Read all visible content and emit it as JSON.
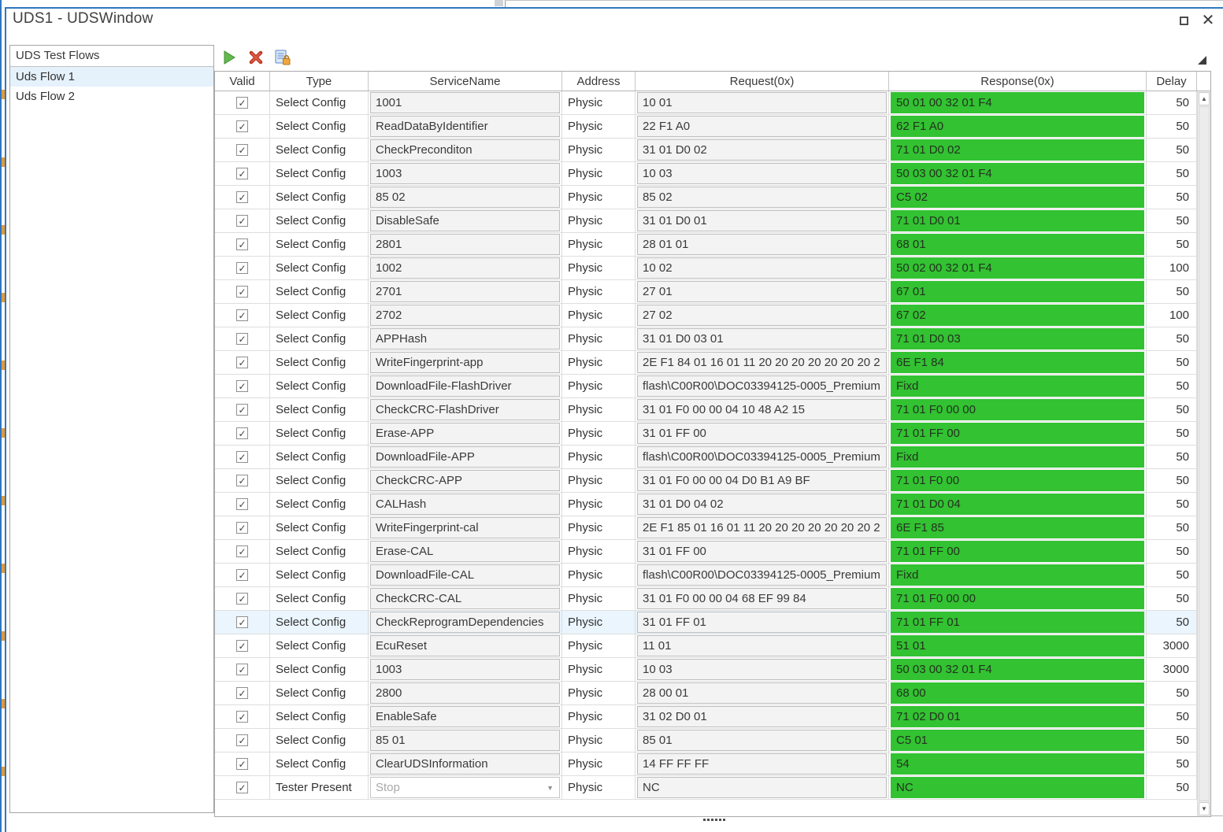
{
  "window": {
    "title": "UDS1 - UDSWindow",
    "close_glyph": "✕"
  },
  "sidebar": {
    "header": "UDS Test Flows",
    "items": [
      {
        "label": "Uds Flow 1",
        "selected": true
      },
      {
        "label": "Uds Flow 2",
        "selected": false
      }
    ]
  },
  "toolbar": {
    "icons": [
      "run",
      "delete",
      "report-locked"
    ]
  },
  "icons": {
    "check": "✓",
    "dropdown_arrow": "▼",
    "scroll_up": "▲",
    "scroll_down": "▼"
  },
  "colors": {
    "accent_blue": "#2e77c0",
    "response_green": "#32c232",
    "selection_blue": "#eaf5fd",
    "run_green": "#64b94e",
    "delete_red": "#c23825",
    "lock_orange": "#f2a73d"
  },
  "table": {
    "columns": [
      "Valid",
      "Type",
      "ServiceName",
      "Address",
      "Request(0x)",
      "Response(0x)",
      "Delay"
    ],
    "rows": [
      {
        "valid": true,
        "type": "Select Config",
        "service": "1001",
        "address": "Physic",
        "request": "10 01",
        "response": "50 01 00 32 01 F4",
        "delay": "50"
      },
      {
        "valid": true,
        "type": "Select Config",
        "service": "ReadDataByIdentifier",
        "address": "Physic",
        "request": "22 F1 A0",
        "response": "62 F1 A0",
        "delay": "50"
      },
      {
        "valid": true,
        "type": "Select Config",
        "service": "CheckPreconditon",
        "address": "Physic",
        "request": "31 01 D0 02",
        "response": "71 01 D0 02",
        "delay": "50"
      },
      {
        "valid": true,
        "type": "Select Config",
        "service": "1003",
        "address": "Physic",
        "request": "10 03",
        "response": "50 03 00 32 01 F4",
        "delay": "50"
      },
      {
        "valid": true,
        "type": "Select Config",
        "service": "85 02",
        "address": "Physic",
        "request": "85 02",
        "response": "C5 02",
        "delay": "50"
      },
      {
        "valid": true,
        "type": "Select Config",
        "service": "DisableSafe",
        "address": "Physic",
        "request": "31 01 D0 01",
        "response": "71 01 D0 01",
        "delay": "50"
      },
      {
        "valid": true,
        "type": "Select Config",
        "service": "2801",
        "address": "Physic",
        "request": "28 01 01",
        "response": "68 01",
        "delay": "50"
      },
      {
        "valid": true,
        "type": "Select Config",
        "service": "1002",
        "address": "Physic",
        "request": "10 02",
        "response": "50 02 00 32 01 F4",
        "delay": "100"
      },
      {
        "valid": true,
        "type": "Select Config",
        "service": "2701",
        "address": "Physic",
        "request": "27 01",
        "response": "67 01",
        "delay": "50"
      },
      {
        "valid": true,
        "type": "Select Config",
        "service": "2702",
        "address": "Physic",
        "request": "27 02",
        "response": "67 02",
        "delay": "100"
      },
      {
        "valid": true,
        "type": "Select Config",
        "service": "APPHash",
        "address": "Physic",
        "request": "31 01 D0 03 01",
        "response": "71 01 D0 03",
        "delay": "50"
      },
      {
        "valid": true,
        "type": "Select Config",
        "service": "WriteFingerprint-app",
        "address": "Physic",
        "request": "2E F1 84 01 16 01 11 20 20 20 20 20 20 20 2",
        "response": "6E F1 84",
        "delay": "50"
      },
      {
        "valid": true,
        "type": "Select Config",
        "service": "DownloadFile-FlashDriver",
        "address": "Physic",
        "request": "flash\\C00R00\\DOC03394125-0005_Premium",
        "response": "Fixd",
        "delay": "50"
      },
      {
        "valid": true,
        "type": "Select Config",
        "service": "CheckCRC-FlashDriver",
        "address": "Physic",
        "request": "31 01 F0 00 00 04 10 48 A2 15",
        "response": "71 01 F0 00 00",
        "delay": "50"
      },
      {
        "valid": true,
        "type": "Select Config",
        "service": "Erase-APP",
        "address": "Physic",
        "request": "31 01 FF 00",
        "response": "71 01 FF 00",
        "delay": "50"
      },
      {
        "valid": true,
        "type": "Select Config",
        "service": "DownloadFile-APP",
        "address": "Physic",
        "request": "flash\\C00R00\\DOC03394125-0005_Premium",
        "response": "Fixd",
        "delay": "50"
      },
      {
        "valid": true,
        "type": "Select Config",
        "service": "CheckCRC-APP",
        "address": "Physic",
        "request": "31 01 F0 00 00 04 D0 B1 A9 BF",
        "response": "71 01 F0 00",
        "delay": "50"
      },
      {
        "valid": true,
        "type": "Select Config",
        "service": "CALHash",
        "address": "Physic",
        "request": "31 01 D0 04 02",
        "response": "71 01 D0 04",
        "delay": "50"
      },
      {
        "valid": true,
        "type": "Select Config",
        "service": "WriteFingerprint-cal",
        "address": "Physic",
        "request": "2E F1 85 01 16 01 11 20 20 20 20 20 20 20 2",
        "response": "6E F1 85",
        "delay": "50"
      },
      {
        "valid": true,
        "type": "Select Config",
        "service": "Erase-CAL",
        "address": "Physic",
        "request": "31 01 FF 00",
        "response": "71 01 FF 00",
        "delay": "50"
      },
      {
        "valid": true,
        "type": "Select Config",
        "service": "DownloadFile-CAL",
        "address": "Physic",
        "request": "flash\\C00R00\\DOC03394125-0005_Premium",
        "response": "Fixd",
        "delay": "50"
      },
      {
        "valid": true,
        "type": "Select Config",
        "service": "CheckCRC-CAL",
        "address": "Physic",
        "request": "31 01 F0 00 00 04 68 EF 99 84",
        "response": "71 01 F0 00 00",
        "delay": "50"
      },
      {
        "valid": true,
        "type": "Select Config",
        "service": "CheckReprogramDependencies",
        "address": "Physic",
        "request": "31 01 FF 01",
        "response": "71 01 FF 01",
        "delay": "50",
        "selected": true
      },
      {
        "valid": true,
        "type": "Select Config",
        "service": "EcuReset",
        "address": "Physic",
        "request": "11 01",
        "response": "51 01",
        "delay": "3000"
      },
      {
        "valid": true,
        "type": "Select Config",
        "service": "1003",
        "address": "Physic",
        "request": "10 03",
        "response": "50 03 00 32 01 F4",
        "delay": "3000"
      },
      {
        "valid": true,
        "type": "Select Config",
        "service": "2800",
        "address": "Physic",
        "request": "28 00 01",
        "response": "68 00",
        "delay": "50"
      },
      {
        "valid": true,
        "type": "Select Config",
        "service": "EnableSafe",
        "address": "Physic",
        "request": "31 02 D0 01",
        "response": "71 02 D0 01",
        "delay": "50"
      },
      {
        "valid": true,
        "type": "Select Config",
        "service": "85 01",
        "address": "Physic",
        "request": "85 01",
        "response": "C5 01",
        "delay": "50"
      },
      {
        "valid": true,
        "type": "Select Config",
        "service": "ClearUDSInformation",
        "address": "Physic",
        "request": "14 FF FF FF",
        "response": "54",
        "delay": "50"
      },
      {
        "valid": true,
        "type": "Tester Present",
        "service": "Stop",
        "service_dropdown": true,
        "address": "Physic",
        "request": "NC",
        "response": "NC",
        "delay": "50"
      }
    ]
  }
}
